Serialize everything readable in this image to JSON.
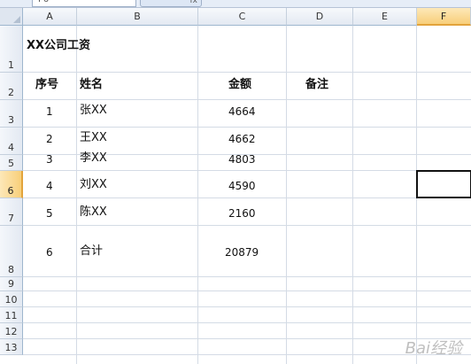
{
  "formula_bar": {
    "name_box": "F6",
    "fx_label": "fx"
  },
  "columns": [
    {
      "label": "A",
      "active": false
    },
    {
      "label": "B",
      "active": false
    },
    {
      "label": "C",
      "active": false
    },
    {
      "label": "D",
      "active": false
    },
    {
      "label": "E",
      "active": false
    },
    {
      "label": "F",
      "active": true
    }
  ],
  "rows": [
    "1",
    "2",
    "3",
    "4",
    "5",
    "6",
    "7",
    "8",
    "9",
    "10",
    "11",
    "12",
    "13"
  ],
  "active_row": "6",
  "title": "XX公司工资",
  "headers": {
    "seq": "序号",
    "name": "姓名",
    "amount": "金额",
    "remark": "备注"
  },
  "records": [
    {
      "seq": "1",
      "name": "张XX",
      "amount": "4664"
    },
    {
      "seq": "2",
      "name": "王XX",
      "amount": "4662"
    },
    {
      "seq": "3",
      "name": "李XX",
      "amount": "4803"
    },
    {
      "seq": "4",
      "name": "刘XX",
      "amount": "4590"
    },
    {
      "seq": "5",
      "name": "陈XX",
      "amount": "2160"
    }
  ],
  "total": {
    "seq": "6",
    "name": "合计",
    "amount": "20879"
  },
  "watermark": "Bai经验"
}
